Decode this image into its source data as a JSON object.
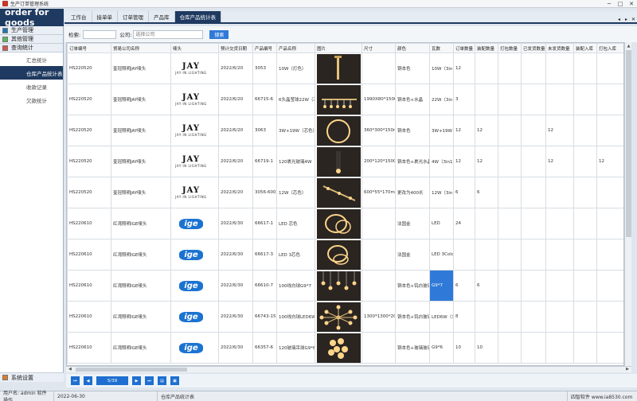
{
  "window": {
    "title": "生产订单管理系统"
  },
  "brand": "order for goods",
  "sidebar": {
    "groups": [
      {
        "label": "生产管理",
        "color": "#1f77b4"
      },
      {
        "label": "其他管理",
        "color": "#5cb85c"
      },
      {
        "label": "查询统计",
        "color": "#d9534f"
      }
    ],
    "items": [
      {
        "label": "汇总统计"
      },
      {
        "label": "仓库产品统计表"
      },
      {
        "label": "收款记录"
      },
      {
        "label": "欠款统计"
      }
    ],
    "bottom": {
      "label": "系统设置"
    }
  },
  "tabs": [
    {
      "label": "工作台"
    },
    {
      "label": "接单单"
    },
    {
      "label": "订单管理"
    },
    {
      "label": "产品库"
    },
    {
      "label": "仓库产品统计表"
    }
  ],
  "filter": {
    "search_label": "检索:",
    "company_label": "公司:",
    "company_placeholder": "选择公司",
    "search_button": "搜索"
  },
  "table": {
    "columns": [
      "订单编号",
      "贸易公司名称",
      "唛头",
      "预计交货日期",
      "产品编号",
      "产品名称",
      "图片",
      "尺寸",
      "颜色",
      "瓦数",
      "订单数量",
      "装配数量",
      "打包数量",
      "已发货数量",
      "未发货数量",
      "装配入库",
      "打包入库"
    ],
    "rows": [
      {
        "order": "HS220520",
        "company": "奎冠照明JAY唛头",
        "mark": "jay",
        "date": "2022/6/20",
        "code": "3053",
        "name": "10W（灯色）",
        "photo": "wall",
        "size": "",
        "color": "铜本色",
        "watt": "10W（3in1）",
        "qty": "12",
        "asm": "",
        "pack": "",
        "shipped": "",
        "unshipped": "",
        "asm_in": "",
        "pack_in": ""
      },
      {
        "order": "HS220520",
        "company": "奎冠照明JAY唛头",
        "mark": "jay",
        "date": "2022/6/20",
        "code": "66715-6",
        "name": "6头晶莹球22W（芯",
        "photo": "linear",
        "size": "1990X80*1500mm",
        "color": "铜本色+水晶",
        "watt": "22W（3in1）",
        "qty": "3",
        "asm": "",
        "pack": "",
        "shipped": "",
        "unshipped": "",
        "asm_in": "",
        "pack_in": ""
      },
      {
        "order": "HS220520",
        "company": "奎冠照明JAY唛头",
        "mark": "jay",
        "date": "2022/6/20",
        "code": "3063",
        "name": "3W+19W（芯色）",
        "photo": "ring",
        "size": "360*300*150mm",
        "color": "铜本色",
        "watt": "3W+19W（3i",
        "qty": "12",
        "asm": "12",
        "pack": "",
        "shipped": "",
        "unshipped": "12",
        "asm_in": "",
        "pack_in": ""
      },
      {
        "order": "HS220520",
        "company": "奎冠照明JAY唛头",
        "mark": "jay",
        "date": "2022/6/20",
        "code": "66719-1",
        "name": "120裹光玻璃4W（芯",
        "photo": "dark",
        "size": "200*120*1500mm",
        "color": "铜本色+裹光水晶",
        "watt": "4W（3in1）",
        "qty": "12",
        "asm": "12",
        "pack": "",
        "shipped": "",
        "unshipped": "12",
        "asm_in": "",
        "pack_in": "12"
      },
      {
        "order": "HS220520",
        "company": "奎冠照明JAY唛头",
        "mark": "jay",
        "date": "2022/6/20",
        "code": "3056-600",
        "name": "12W（芯色）",
        "photo": "spot",
        "size": "600*55*170mm",
        "color": "更改为400长",
        "watt": "12W（3in1）",
        "qty": "6",
        "asm": "6",
        "pack": "",
        "shipped": "",
        "unshipped": "",
        "asm_in": "",
        "pack_in": ""
      },
      {
        "order": "HS220610",
        "company": "红湾照明IGE唛头",
        "mark": "ige",
        "date": "2022/6/30",
        "code": "66617-1",
        "name": "LED 芯色",
        "photo": "rings",
        "size": "",
        "color": "法国金",
        "watt": "LED",
        "qty": "24",
        "asm": "",
        "pack": "",
        "shipped": "",
        "unshipped": "",
        "asm_in": "",
        "pack_in": ""
      },
      {
        "order": "HS220610",
        "company": "红湾照明IGE唛头",
        "mark": "ige",
        "date": "2022/6/30",
        "code": "66617-3",
        "name": "LED 3芯色",
        "photo": "rings2",
        "size": "",
        "color": "法国金",
        "watt": "LED 3Color",
        "qty": "",
        "asm": "",
        "pack": "",
        "shipped": "",
        "unshipped": "",
        "asm_in": "",
        "pack_in": ""
      },
      {
        "order": "HS220610",
        "company": "红湾照明IGE唛头",
        "mark": "ige",
        "date": "2022/6/30",
        "code": "66610-7",
        "name": "100线白球G9*7",
        "photo": "drops",
        "size": "",
        "color": "铜本色+钨白玻璃",
        "watt": "G9*7",
        "qty": "6",
        "asm": "6",
        "pack": "",
        "shipped": "",
        "unshipped": "",
        "asm_in": "",
        "pack_in": "",
        "hl": true
      },
      {
        "order": "HS220610",
        "company": "红湾照明IGE唛头",
        "mark": "ige",
        "date": "2022/6/30",
        "code": "66743-15",
        "name": "100线白球LED6W（2",
        "photo": "sputnik",
        "size": "1300*1300*200mm",
        "color": "铜本色+钨白玻璃",
        "watt": "LED6W（3in",
        "qty": "8",
        "asm": "",
        "pack": "",
        "shipped": "",
        "unshipped": "",
        "asm_in": "",
        "pack_in": ""
      },
      {
        "order": "HS220610",
        "company": "红湾照明IGE唛头",
        "mark": "ige",
        "date": "2022/6/30",
        "code": "66357-6",
        "name": "120玻璃吊球G9*6",
        "photo": "cluster",
        "size": "",
        "color": "铜本色+玻璃玻璃",
        "watt": "G9*6",
        "qty": "10",
        "asm": "10",
        "pack": "",
        "shipped": "",
        "unshipped": "",
        "asm_in": "",
        "pack_in": ""
      }
    ]
  },
  "marks": {
    "jay": {
      "big": "JAY",
      "small": "JAY·IN LIGHTING"
    },
    "ige": {
      "big": "ige"
    }
  },
  "pager": {
    "info": "5/39"
  },
  "status": {
    "user": "用户名: admin 软件操作",
    "date": "2022-06-30",
    "page": "仓库产品统计表",
    "vendor": "四智软件  www.ia8530.com"
  }
}
